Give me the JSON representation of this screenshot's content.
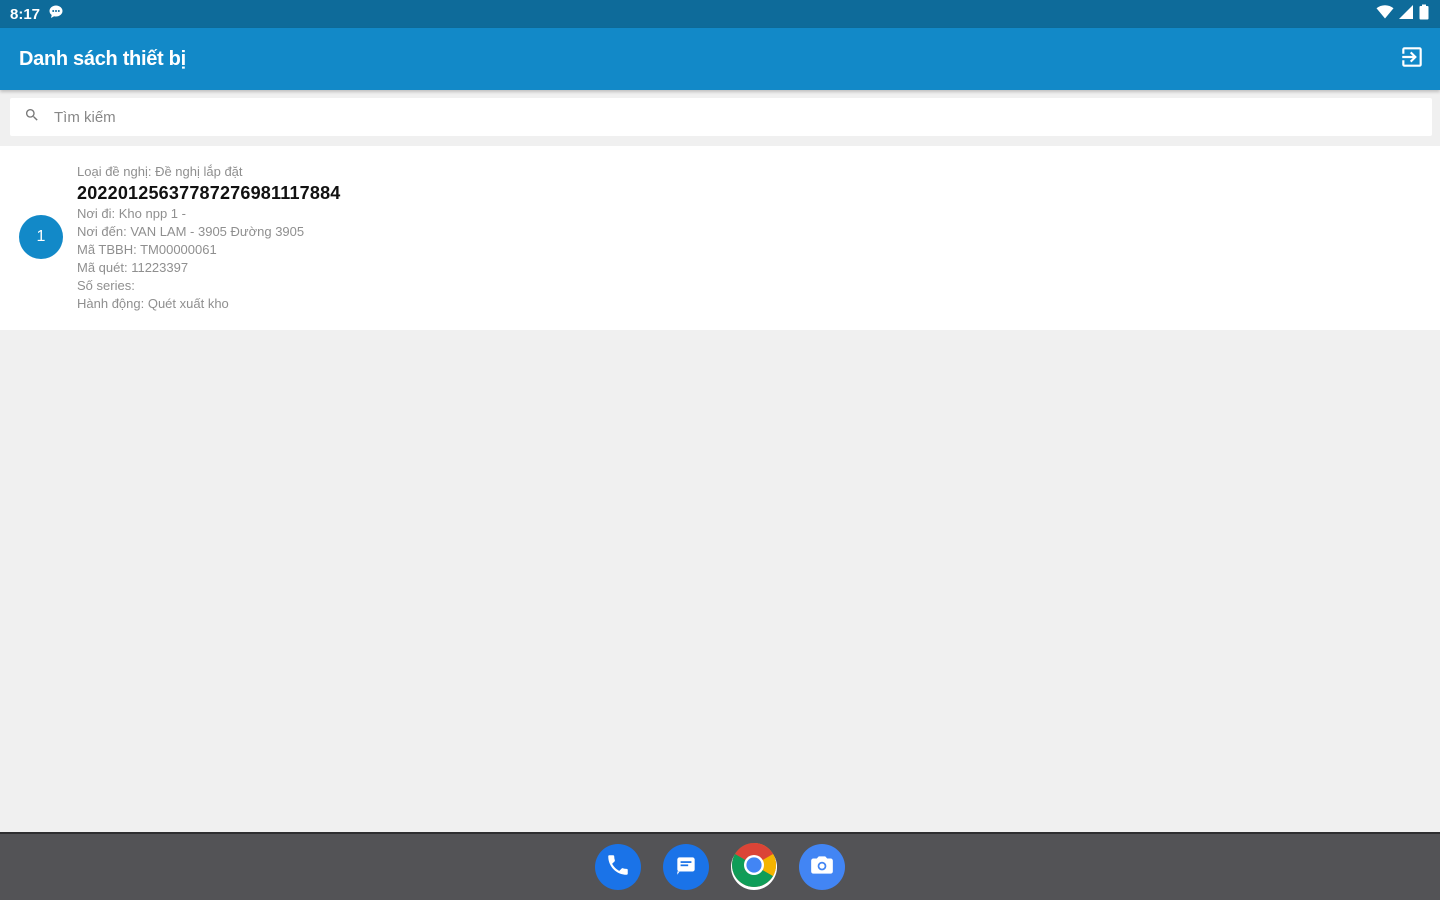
{
  "status_bar": {
    "time": "8:17",
    "icons": [
      "chat-notification-icon",
      "wifi-icon",
      "signal-icon",
      "battery-icon"
    ]
  },
  "app_bar": {
    "title": "Danh sách thiết bị",
    "action_icon": "logout-icon"
  },
  "search": {
    "placeholder": "Tìm kiếm",
    "value": ""
  },
  "devices": [
    {
      "index": "1",
      "request_type": "Loại đề nghị: Đề nghị lắp đặt",
      "code": "20220125637787276981117884",
      "from": "Nơi đi: Kho npp 1 -",
      "to": "Nơi đến: VAN LAM - 3905 Đường 3905",
      "tbbh_code": "Mã TBBH: TM00000061",
      "scan_code": "Mã quét: 11223397",
      "serial": "Số series:",
      "action": "Hành động: Quét xuất kho"
    }
  ],
  "dock": {
    "apps": [
      "phone-icon",
      "messages-icon",
      "chrome-icon",
      "camera-icon"
    ]
  },
  "colors": {
    "status_bar": "#0e6b9a",
    "app_bar": "#1289c8",
    "badge": "#1289c8",
    "background": "#f0f0f0",
    "nav_bar": "#535356"
  }
}
